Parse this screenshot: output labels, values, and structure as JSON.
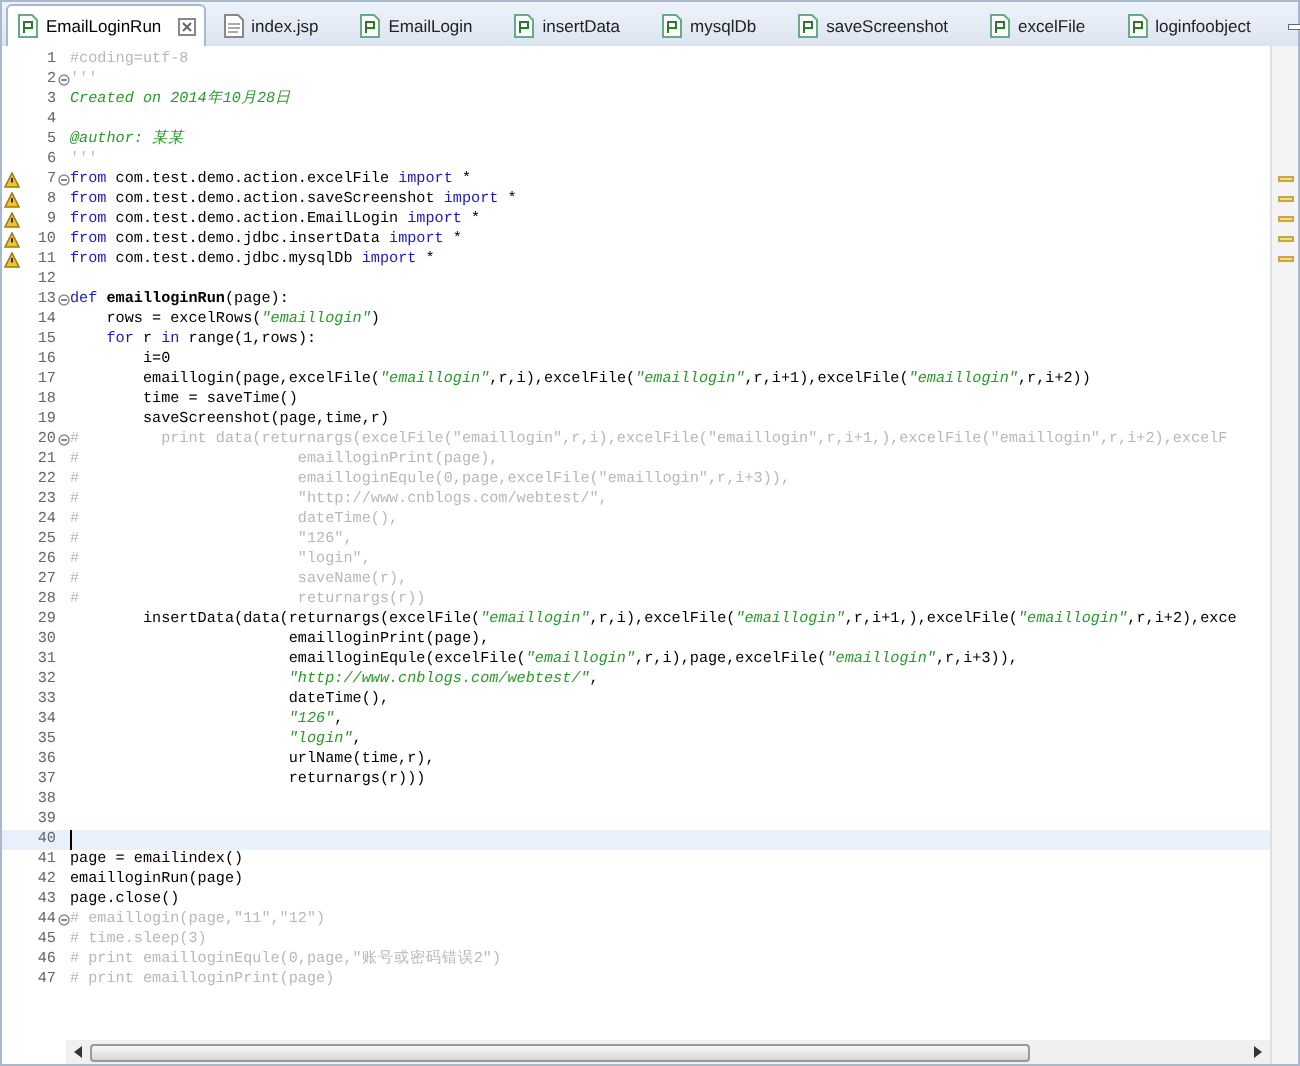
{
  "tabs": [
    {
      "label": "EmailLoginRun",
      "kind": "python",
      "selected": true
    },
    {
      "label": "index.jsp",
      "kind": "file",
      "selected": false
    },
    {
      "label": "EmailLogin",
      "kind": "python",
      "selected": false
    },
    {
      "label": "insertData",
      "kind": "python",
      "selected": false
    },
    {
      "label": "mysqlDb",
      "kind": "python",
      "selected": false
    },
    {
      "label": "saveScreenshot",
      "kind": "python",
      "selected": false
    },
    {
      "label": "excelFile",
      "kind": "python",
      "selected": false
    },
    {
      "label": "loginfoobject",
      "kind": "python",
      "selected": false
    }
  ],
  "editor": {
    "lines": [
      {
        "number": "1",
        "warning": false,
        "fold": false,
        "current": false,
        "tokens": [
          {
            "text": "#coding=utf-8",
            "kind": "comment"
          }
        ]
      },
      {
        "number": "2",
        "warning": false,
        "fold": true,
        "current": false,
        "tokens": [
          {
            "text": "'''",
            "kind": "comment"
          }
        ]
      },
      {
        "number": "3",
        "warning": false,
        "fold": false,
        "current": false,
        "tokens": [
          {
            "text": "Created on 2014年10月28日",
            "kind": "doc"
          }
        ]
      },
      {
        "number": "4",
        "warning": false,
        "fold": false,
        "current": false
      },
      {
        "number": "5",
        "warning": false,
        "fold": false,
        "current": false,
        "tokens": [
          {
            "text": "@author: 某某",
            "kind": "doc"
          }
        ]
      },
      {
        "number": "6",
        "warning": false,
        "fold": false,
        "current": false,
        "tokens": [
          {
            "text": "'''",
            "kind": "comment"
          }
        ]
      },
      {
        "number": "7",
        "warning": true,
        "fold": true,
        "current": false,
        "tokens": [
          {
            "text": "from",
            "kind": "keyword"
          },
          {
            "text": " com.test.demo.action.excelFile ",
            "kind": "plain"
          },
          {
            "text": "import",
            "kind": "keyword"
          },
          {
            "text": " *",
            "kind": "plain"
          }
        ]
      },
      {
        "number": "8",
        "warning": true,
        "fold": false,
        "current": false,
        "tokens": [
          {
            "text": "from",
            "kind": "keyword"
          },
          {
            "text": " com.test.demo.action.saveScreenshot ",
            "kind": "plain"
          },
          {
            "text": "import",
            "kind": "keyword"
          },
          {
            "text": " *",
            "kind": "plain"
          }
        ]
      },
      {
        "number": "9",
        "warning": true,
        "fold": false,
        "current": false,
        "tokens": [
          {
            "text": "from",
            "kind": "keyword"
          },
          {
            "text": " com.test.demo.action.EmailLogin ",
            "kind": "plain"
          },
          {
            "text": "import",
            "kind": "keyword"
          },
          {
            "text": " *",
            "kind": "plain"
          }
        ]
      },
      {
        "number": "10",
        "warning": true,
        "fold": false,
        "current": false,
        "tokens": [
          {
            "text": "from",
            "kind": "keyword"
          },
          {
            "text": " com.test.demo.jdbc.insertData ",
            "kind": "plain"
          },
          {
            "text": "import",
            "kind": "keyword"
          },
          {
            "text": " *",
            "kind": "plain"
          }
        ]
      },
      {
        "number": "11",
        "warning": true,
        "fold": false,
        "current": false,
        "tokens": [
          {
            "text": "from",
            "kind": "keyword"
          },
          {
            "text": " com.test.demo.jdbc.mysqlDb ",
            "kind": "plain"
          },
          {
            "text": "import",
            "kind": "keyword"
          },
          {
            "text": " *",
            "kind": "plain"
          }
        ]
      },
      {
        "number": "12",
        "warning": false,
        "fold": false,
        "current": false
      },
      {
        "number": "13",
        "warning": false,
        "fold": true,
        "current": false,
        "tokens": [
          {
            "text": "def",
            "kind": "keyword"
          },
          {
            "text": " emailloginRun",
            "kind": "name"
          },
          {
            "text": "(page):",
            "kind": "plain"
          }
        ]
      },
      {
        "number": "14",
        "warning": false,
        "fold": false,
        "current": false,
        "tokens": [
          {
            "text": "    rows = excelRows(",
            "kind": "plain"
          },
          {
            "text": "\"emaillogin\"",
            "kind": "string"
          },
          {
            "text": ")",
            "kind": "plain"
          }
        ]
      },
      {
        "number": "15",
        "warning": false,
        "fold": false,
        "current": false,
        "tokens": [
          {
            "text": "    for",
            "kind": "keyword"
          },
          {
            "text": " r ",
            "kind": "plain"
          },
          {
            "text": "in",
            "kind": "keyword"
          },
          {
            "text": " range(1,rows):",
            "kind": "plain"
          }
        ]
      },
      {
        "number": "16",
        "warning": false,
        "fold": false,
        "current": false,
        "tokens": [
          {
            "text": "        i=0",
            "kind": "plain"
          }
        ]
      },
      {
        "number": "17",
        "warning": false,
        "fold": false,
        "current": false,
        "tokens": [
          {
            "text": "        emaillogin(page,excelFile(",
            "kind": "plain"
          },
          {
            "text": "\"emaillogin\"",
            "kind": "string"
          },
          {
            "text": ",r,i),excelFile(",
            "kind": "plain"
          },
          {
            "text": "\"emaillogin\"",
            "kind": "string"
          },
          {
            "text": ",r,i+1),excelFile(",
            "kind": "plain"
          },
          {
            "text": "\"emaillogin\"",
            "kind": "string"
          },
          {
            "text": ",r,i+2))",
            "kind": "plain"
          }
        ]
      },
      {
        "number": "18",
        "warning": false,
        "fold": false,
        "current": false,
        "tokens": [
          {
            "text": "        time = saveTime()",
            "kind": "plain"
          }
        ]
      },
      {
        "number": "19",
        "warning": false,
        "fold": false,
        "current": false,
        "tokens": [
          {
            "text": "        saveScreenshot(page,time,r)",
            "kind": "plain"
          }
        ]
      },
      {
        "number": "20",
        "warning": false,
        "fold": true,
        "current": false,
        "tokens": [
          {
            "text": "#         print data(returnargs(excelFile(\"emaillogin\",r,i),excelFile(\"emaillogin\",r,i+1,),excelFile(\"emaillogin\",r,i+2),excelF",
            "kind": "comment"
          }
        ]
      },
      {
        "number": "21",
        "warning": false,
        "fold": false,
        "current": false,
        "tokens": [
          {
            "text": "#                        emailloginPrint(page),",
            "kind": "comment"
          }
        ]
      },
      {
        "number": "22",
        "warning": false,
        "fold": false,
        "current": false,
        "tokens": [
          {
            "text": "#                        emailloginEqule(0,page,excelFile(\"emaillogin\",r,i+3)),",
            "kind": "comment"
          }
        ]
      },
      {
        "number": "23",
        "warning": false,
        "fold": false,
        "current": false,
        "tokens": [
          {
            "text": "#                        \"http://www.cnblogs.com/webtest/\",",
            "kind": "comment"
          }
        ]
      },
      {
        "number": "24",
        "warning": false,
        "fold": false,
        "current": false,
        "tokens": [
          {
            "text": "#                        dateTime(),",
            "kind": "comment"
          }
        ]
      },
      {
        "number": "25",
        "warning": false,
        "fold": false,
        "current": false,
        "tokens": [
          {
            "text": "#                        \"126\",",
            "kind": "comment"
          }
        ]
      },
      {
        "number": "26",
        "warning": false,
        "fold": false,
        "current": false,
        "tokens": [
          {
            "text": "#                        \"login\",",
            "kind": "comment"
          }
        ]
      },
      {
        "number": "27",
        "warning": false,
        "fold": false,
        "current": false,
        "tokens": [
          {
            "text": "#                        saveName(r),",
            "kind": "comment"
          }
        ]
      },
      {
        "number": "28",
        "warning": false,
        "fold": false,
        "current": false,
        "tokens": [
          {
            "text": "#                        returnargs(r))",
            "kind": "comment"
          }
        ]
      },
      {
        "number": "29",
        "warning": false,
        "fold": false,
        "current": false,
        "tokens": [
          {
            "text": "        insertData(data(returnargs(excelFile(",
            "kind": "plain"
          },
          {
            "text": "\"emaillogin\"",
            "kind": "string"
          },
          {
            "text": ",r,i),excelFile(",
            "kind": "plain"
          },
          {
            "text": "\"emaillogin\"",
            "kind": "string"
          },
          {
            "text": ",r,i+1,),excelFile(",
            "kind": "plain"
          },
          {
            "text": "\"emaillogin\"",
            "kind": "string"
          },
          {
            "text": ",r,i+2),exce",
            "kind": "plain"
          }
        ]
      },
      {
        "number": "30",
        "warning": false,
        "fold": false,
        "current": false,
        "tokens": [
          {
            "text": "                        emailloginPrint(page),",
            "kind": "plain"
          }
        ]
      },
      {
        "number": "31",
        "warning": false,
        "fold": false,
        "current": false,
        "tokens": [
          {
            "text": "                        emailloginEqule(excelFile(",
            "kind": "plain"
          },
          {
            "text": "\"emaillogin\"",
            "kind": "string"
          },
          {
            "text": ",r,i),page,excelFile(",
            "kind": "plain"
          },
          {
            "text": "\"emaillogin\"",
            "kind": "string"
          },
          {
            "text": ",r,i+3)),",
            "kind": "plain"
          }
        ]
      },
      {
        "number": "32",
        "warning": false,
        "fold": false,
        "current": false,
        "tokens": [
          {
            "text": "                        \"http://www.cnblogs.com/webtest/\"",
            "kind": "string"
          },
          {
            "text": ",",
            "kind": "plain"
          }
        ]
      },
      {
        "number": "33",
        "warning": false,
        "fold": false,
        "current": false,
        "tokens": [
          {
            "text": "                        dateTime(),",
            "kind": "plain"
          }
        ]
      },
      {
        "number": "34",
        "warning": false,
        "fold": false,
        "current": false,
        "tokens": [
          {
            "text": "                        \"126\"",
            "kind": "string"
          },
          {
            "text": ",",
            "kind": "plain"
          }
        ]
      },
      {
        "number": "35",
        "warning": false,
        "fold": false,
        "current": false,
        "tokens": [
          {
            "text": "                        \"login\"",
            "kind": "string"
          },
          {
            "text": ",",
            "kind": "plain"
          }
        ]
      },
      {
        "number": "36",
        "warning": false,
        "fold": false,
        "current": false,
        "tokens": [
          {
            "text": "                        urlName(time,r),",
            "kind": "plain"
          }
        ]
      },
      {
        "number": "37",
        "warning": false,
        "fold": false,
        "current": false,
        "tokens": [
          {
            "text": "                        returnargs(r)))",
            "kind": "plain"
          }
        ]
      },
      {
        "number": "38",
        "warning": false,
        "fold": false,
        "current": false
      },
      {
        "number": "39",
        "warning": false,
        "fold": false,
        "current": false
      },
      {
        "number": "40",
        "warning": false,
        "fold": false,
        "current": true
      },
      {
        "number": "41",
        "warning": false,
        "fold": false,
        "current": false,
        "tokens": [
          {
            "text": "page = emailindex()",
            "kind": "plain"
          }
        ]
      },
      {
        "number": "42",
        "warning": false,
        "fold": false,
        "current": false,
        "tokens": [
          {
            "text": "emailloginRun(page)",
            "kind": "plain"
          }
        ]
      },
      {
        "number": "43",
        "warning": false,
        "fold": false,
        "current": false,
        "tokens": [
          {
            "text": "page.close()",
            "kind": "plain"
          }
        ]
      },
      {
        "number": "44",
        "warning": false,
        "fold": true,
        "current": false,
        "tokens": [
          {
            "text": "# emaillogin(page,\"11\",\"12\")",
            "kind": "comment"
          }
        ]
      },
      {
        "number": "45",
        "warning": false,
        "fold": false,
        "current": false,
        "tokens": [
          {
            "text": "# time.sleep(3)",
            "kind": "comment"
          }
        ]
      },
      {
        "number": "46",
        "warning": false,
        "fold": false,
        "current": false,
        "tokens": [
          {
            "text": "# print emailloginEqule(0,page,\"账号或密码错误2\")",
            "kind": "comment"
          }
        ]
      },
      {
        "number": "47",
        "warning": false,
        "fold": false,
        "current": false,
        "tokens": [
          {
            "text": "# print emailloginPrint(page)",
            "kind": "comment"
          }
        ]
      }
    ]
  }
}
